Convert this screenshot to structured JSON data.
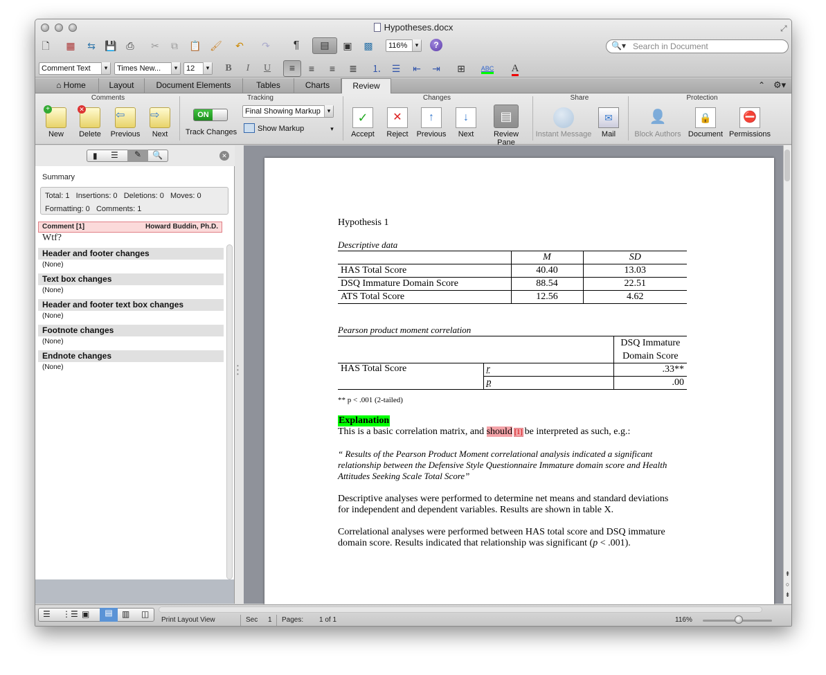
{
  "window": {
    "title": "Hypotheses.docx"
  },
  "toolbar": {
    "zoom": "116%",
    "search_placeholder": "Search in Document",
    "style_value": "Comment Text",
    "font_value": "Times New...",
    "size_value": "12"
  },
  "tabs": [
    "Home",
    "Layout",
    "Document Elements",
    "Tables",
    "Charts",
    "Review"
  ],
  "ribbon": {
    "groups": [
      "Comments",
      "Tracking",
      "Changes",
      "Share",
      "Protection"
    ],
    "comments": {
      "new": "New",
      "delete": "Delete",
      "previous": "Previous",
      "next": "Next"
    },
    "tracking": {
      "toggle": "ON",
      "track_changes": "Track Changes",
      "markup_select": "Final Showing Markup",
      "show_markup": "Show Markup"
    },
    "changes": {
      "accept": "Accept",
      "reject": "Reject",
      "previous": "Previous",
      "next": "Next",
      "review_pane": "Review Pane"
    },
    "share": {
      "instant_message": "Instant Message",
      "mail": "Mail"
    },
    "protection": {
      "block_authors": "Block Authors",
      "document": "Document",
      "permissions": "Permissions"
    }
  },
  "pane": {
    "summary_title": "Summary",
    "summary_line1": "Total: 1   Insertions: 0   Deletions: 0   Moves: 0",
    "summary_line2": "Formatting: 0   Comments: 1",
    "comment_label": "Comment [1]",
    "comment_author": "Howard Buddin, Ph.D.",
    "comment_text": "Wtf?",
    "sections": [
      {
        "title": "Header and footer changes",
        "value": "(None)"
      },
      {
        "title": "Text box changes",
        "value": "(None)"
      },
      {
        "title": "Header and footer text box changes",
        "value": "(None)"
      },
      {
        "title": "Footnote changes",
        "value": "(None)"
      },
      {
        "title": "Endnote changes",
        "value": "(None)"
      }
    ]
  },
  "doc": {
    "heading": "Hypothesis 1",
    "desc_caption": "Descriptive data",
    "desc_cols": [
      "M",
      "SD"
    ],
    "desc_rows": [
      [
        "HAS Total Score",
        "40.40",
        "13.03"
      ],
      [
        "DSQ Immature Domain Score",
        "88.54",
        "22.51"
      ],
      [
        "ATS Total Score",
        "12.56",
        "4.62"
      ]
    ],
    "corr_caption": "Pearson product moment correlation",
    "corr_col_line1": "DSQ Immature",
    "corr_col_line2": "Domain Score",
    "corr_row_label": "HAS Total Score",
    "corr_r_label": "r",
    "corr_r_value": ".33**",
    "corr_p_label": "p",
    "corr_p_value": ".00",
    "footnote": "** p < .001 (2-tailed)",
    "explanation_heading": "Explanation",
    "explanation_before": "This is a basic correlation matrix, and ",
    "explanation_highlight": "should",
    "comment_ref": "[1]",
    "explanation_after": "be interpreted as such, e.g.:",
    "quote": "“ Results of the Pearson Product Moment correlational analysis indicated a significant relationship between the Defensive Style Questionnaire Immature domain score and Health Attitudes Seeking Scale Total Score”",
    "para1": "Descriptive analyses were performed to determine net means and standard deviations for independent and dependent variables. Results are shown in table X.",
    "para2_before": "Correlational analyses were performed between HAS total score and DSQ immature domain score. Results indicated that relationship was significant (",
    "para2_p": "p",
    "para2_after": " < .001)."
  },
  "status": {
    "view": "Print Layout View",
    "sec_label": "Sec",
    "sec_value": "1",
    "pages_label": "Pages:",
    "pages_value": "1 of 1",
    "zoom": "116%"
  },
  "colors": {
    "highlight_green": "#00ff00",
    "highlight_pink": "#f4a3a8",
    "comment_box": "#fbdada"
  }
}
